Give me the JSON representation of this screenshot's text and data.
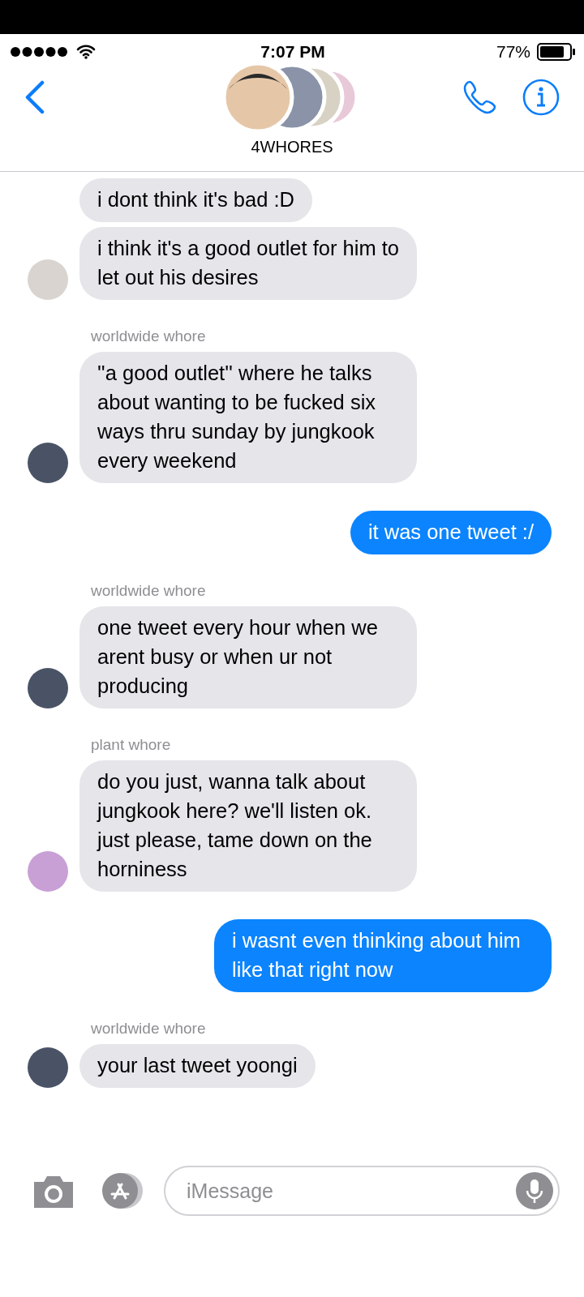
{
  "status_bar": {
    "time": "7:07 PM",
    "battery": "77%"
  },
  "header": {
    "title": "4WHORES"
  },
  "groups": [
    {
      "kind": "received",
      "color": "#d9d4d0",
      "bubbles": [
        "i dont think it's bad :D",
        "i think it's a good outlet for him to let out his desires"
      ]
    },
    {
      "kind": "received",
      "sender": "worldwide whore",
      "color": "#4a5366",
      "bubbles": [
        "''a good outlet'' where he talks about wanting to be fucked six ways thru sunday by jungkook every weekend"
      ]
    },
    {
      "kind": "sent",
      "bubbles": [
        "it was one tweet :/"
      ]
    },
    {
      "kind": "received",
      "sender": "worldwide whore",
      "color": "#4a5366",
      "bubbles": [
        "one tweet every hour when we arent busy or when ur not producing"
      ]
    },
    {
      "kind": "received",
      "sender": "plant whore",
      "color": "#c9a0d6",
      "bubbles": [
        "do you just, wanna talk about jungkook here? we'll listen ok. just please, tame down on the horniness"
      ]
    },
    {
      "kind": "sent",
      "bubbles": [
        "i wasnt even thinking about him like that right now"
      ]
    },
    {
      "kind": "received",
      "sender": "worldwide whore",
      "color": "#4a5366",
      "bubbles": [
        "your last tweet yoongi"
      ]
    }
  ],
  "composer": {
    "placeholder": "iMessage"
  }
}
